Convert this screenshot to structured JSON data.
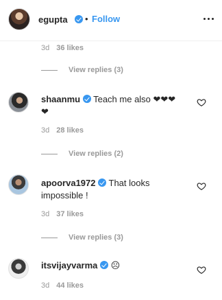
{
  "header": {
    "username": "egupta",
    "separator": "•",
    "follow_label": "Follow"
  },
  "top_meta": {
    "time": "3d",
    "likes": "36 likes"
  },
  "top_replies": {
    "label": "View replies (3)"
  },
  "comments": [
    {
      "user": "shaanmu",
      "text_line1": "Teach me also ❤︎❤︎❤︎",
      "text_line2": "❤︎",
      "time": "3d",
      "likes": "28 likes",
      "replies": "View replies (2)"
    },
    {
      "user": "apoorva1972",
      "text_line1": "That looks",
      "text_line2": "impossible !",
      "time": "3d",
      "likes": "37 likes",
      "replies": "View replies (3)"
    },
    {
      "user": "itsvijayvarma",
      "text_line1": "☹",
      "time": "3d",
      "likes": "44 likes"
    }
  ],
  "colors": {
    "link_blue": "#3897f0",
    "verified_blue": "#3897f0",
    "meta_gray": "#999999",
    "text": "#262626"
  }
}
